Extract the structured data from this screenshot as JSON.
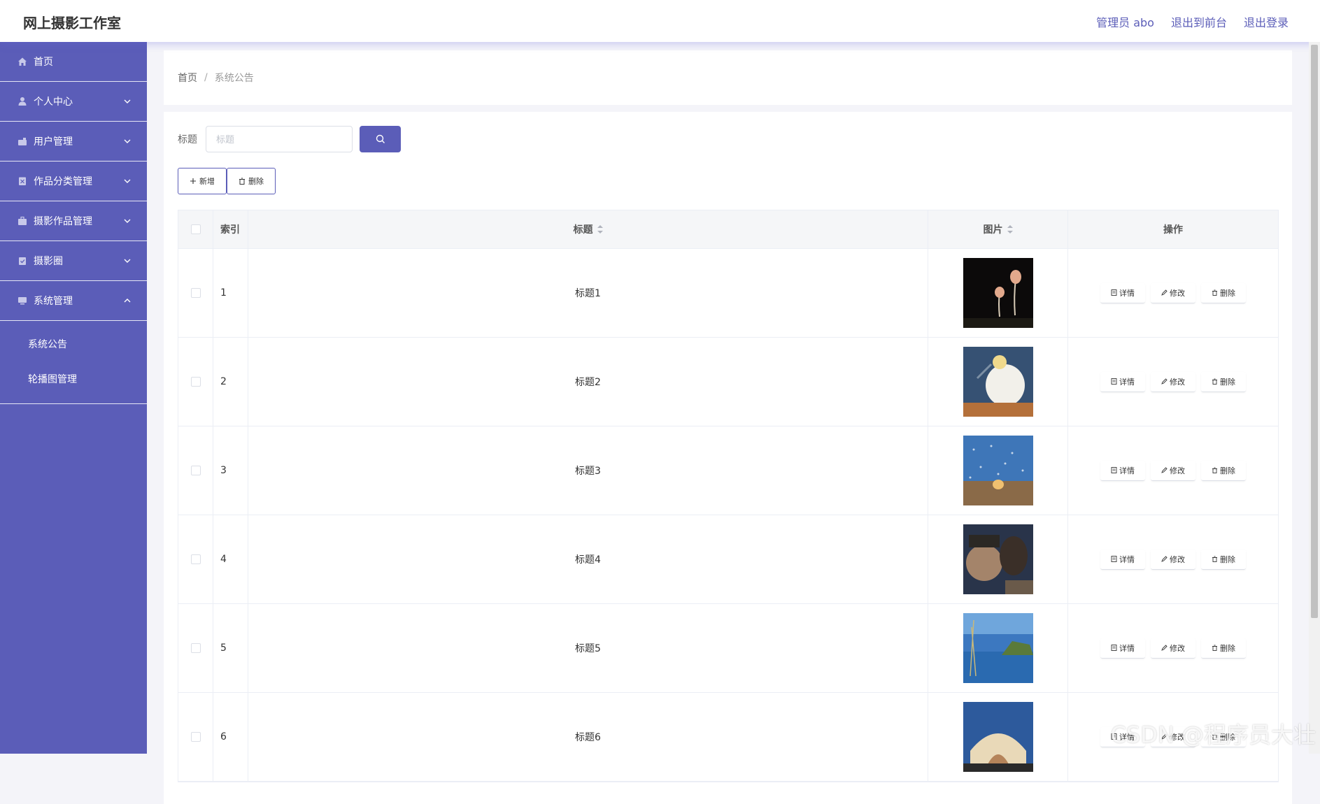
{
  "app": {
    "title": "网上摄影工作室"
  },
  "header": {
    "links": [
      "管理员 abo",
      "退出到前台",
      "退出登录"
    ]
  },
  "sidebar": {
    "items": [
      {
        "label": "首页",
        "icon": "home-icon",
        "has_arrow": false
      },
      {
        "label": "个人中心",
        "icon": "user-icon",
        "has_arrow": true
      },
      {
        "label": "用户管理",
        "icon": "users-icon",
        "has_arrow": true
      },
      {
        "label": "作品分类管理",
        "icon": "category-icon",
        "has_arrow": true
      },
      {
        "label": "摄影作品管理",
        "icon": "briefcase-icon",
        "has_arrow": true
      },
      {
        "label": "摄影圈",
        "icon": "clipboard-icon",
        "has_arrow": true
      },
      {
        "label": "系统管理",
        "icon": "monitor-icon",
        "has_arrow": true,
        "expanded": true
      }
    ],
    "submenu": [
      "系统公告",
      "轮播图管理"
    ]
  },
  "breadcrumb": {
    "home": "首页",
    "separator": "/",
    "current": "系统公告"
  },
  "search": {
    "label": "标题",
    "placeholder": "标题"
  },
  "actions": {
    "add": "新增",
    "delete": "删除"
  },
  "table": {
    "headers": {
      "index": "索引",
      "title": "标题",
      "image": "图片",
      "ops": "操作"
    },
    "op_labels": {
      "detail": "详情",
      "edit": "修改",
      "delete": "删除"
    },
    "rows": [
      {
        "index": "1",
        "title": "标题1"
      },
      {
        "index": "2",
        "title": "标题2"
      },
      {
        "index": "3",
        "title": "标题3"
      },
      {
        "index": "4",
        "title": "标题4"
      },
      {
        "index": "5",
        "title": "标题5"
      },
      {
        "index": "6",
        "title": "标题6"
      }
    ]
  },
  "watermark": "CSDN @程序员大壮",
  "colors": {
    "accent": "#5b5db8",
    "sidebar_bg": "#5b5db8",
    "page_bg": "#f4f4f9"
  }
}
